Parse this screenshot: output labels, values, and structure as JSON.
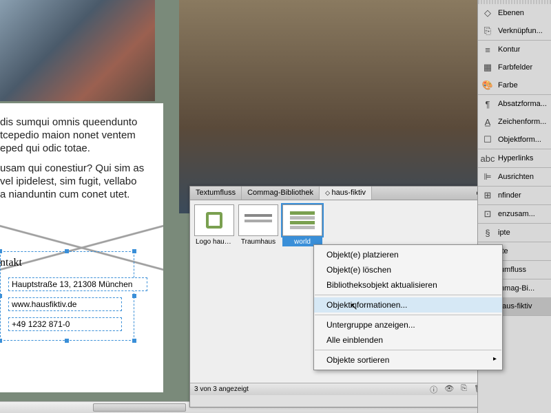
{
  "document": {
    "body_text_1": "dis sumqui omnis queendunto",
    "body_text_2": "tcepedio maion nonet ventem",
    "body_text_3": "eped qui odic totae.",
    "body_text_4": "usam qui conestiur? Qui sim as",
    "body_text_5": "vel ipidelest, sim fugit, vellabo",
    "body_text_6": "a nianduntin cum conet utet.",
    "kontakt_heading": "ntakt",
    "address": "Hauptstraße 13, 21308 München",
    "website": "www.hausfiktiv.de",
    "phone": "+49 1232 871-0"
  },
  "library": {
    "tabs": [
      "Textumfluss",
      "Commag-Bibliothek",
      "haus-fiktiv"
    ],
    "active_tab": 2,
    "items": [
      {
        "label": "Logo hausfi..."
      },
      {
        "label": "Traumhaus"
      },
      {
        "label": "world"
      }
    ],
    "selected_item": 2,
    "status": "3 von 3 angezeigt"
  },
  "context_menu": {
    "items": [
      {
        "label": "Objekt(e) platzieren"
      },
      {
        "label": "Objekt(e) löschen"
      },
      {
        "label": "Bibliotheksobjekt aktualisieren"
      },
      {
        "sep": true
      },
      {
        "label": "Objektinformationen...",
        "hover": true
      },
      {
        "sep": true
      },
      {
        "label": "Untergruppe anzeigen..."
      },
      {
        "label": "Alle einblenden"
      },
      {
        "sep": true
      },
      {
        "label": "Objekte sortieren",
        "submenu": true
      }
    ]
  },
  "dock": {
    "groups": [
      [
        {
          "icon": "◇",
          "label": "Ebenen"
        },
        {
          "icon": "⎘",
          "label": "Verknüpfun..."
        }
      ],
      [
        {
          "icon": "≡",
          "label": "Kontur"
        },
        {
          "icon": "▦",
          "label": "Farbfelder"
        },
        {
          "icon": "🎨",
          "label": "Farbe"
        }
      ],
      [
        {
          "icon": "¶",
          "label": "Absatzforma..."
        },
        {
          "icon": "A̲",
          "label": "Zeichenform..."
        },
        {
          "icon": "☐",
          "label": "Objektform..."
        }
      ],
      [
        {
          "icon": "abc",
          "label": "Hyperlinks"
        }
      ],
      [
        {
          "icon": "⊫",
          "label": "Ausrichten"
        }
      ],
      [
        {
          "icon": "⊞",
          "label": "nfinder"
        }
      ],
      [
        {
          "icon": "⊡",
          "label": "enzusam..."
        }
      ],
      [
        {
          "icon": "§",
          "label": "ipte"
        }
      ],
      [
        {
          "icon": "▭",
          "label": "kte"
        }
      ],
      [
        {
          "icon": "≣",
          "label": "tumfluss"
        }
      ],
      [
        {
          "icon": "📚",
          "label": "mmag-Bi..."
        },
        {
          "icon": "📚",
          "label": "haus-fiktiv",
          "active": true
        }
      ]
    ]
  }
}
